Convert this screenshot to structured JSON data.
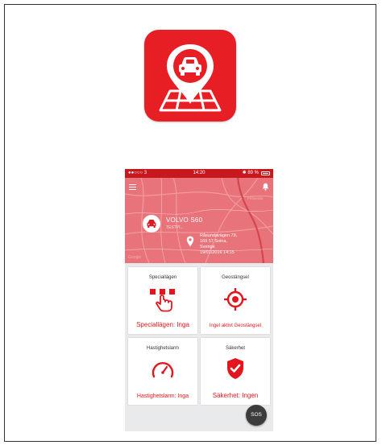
{
  "status_bar": {
    "carrier": "●●○○○ 3",
    "time": "14:20",
    "right": "✱ 89 %"
  },
  "vehicle": {
    "name": "VOLVO S60",
    "subtitle": "TESTPI..."
  },
  "location": {
    "address_line1": "Råsundavägen 79,",
    "address_line2": "169 57 Solna,",
    "address_line3": "Sverige",
    "timestamp": "19/01/2016 14:15"
  },
  "map": {
    "watermark": "Google",
    "place1": "Frösunda"
  },
  "tiles": [
    {
      "title": "Speciallägen",
      "status": "Speciallägen: Inga"
    },
    {
      "title": "Geostängsel",
      "status": "Inget aktivt Geostängsel"
    },
    {
      "title": "Hastighetslarm",
      "status": "Hastighetslarm: Inga"
    },
    {
      "title": "Säkerhet",
      "status": "Säkerhet: Ingen"
    }
  ],
  "sos_label": "SOS",
  "colors": {
    "brand_red": "#e81e25",
    "map_red": "#e8737a",
    "status_bar": "#c9171e",
    "sos_button": "#3c3c3c"
  },
  "icons": {
    "app": "car-location-pin-icon",
    "menu": "hamburger-icon",
    "notifications": "bell-icon",
    "vehicle": "car-icon",
    "location": "map-pin-icon",
    "special_modes": "hand-tap-icon",
    "geofence": "target-icon",
    "speed_alarm": "speedometer-icon",
    "security": "shield-check-icon"
  }
}
